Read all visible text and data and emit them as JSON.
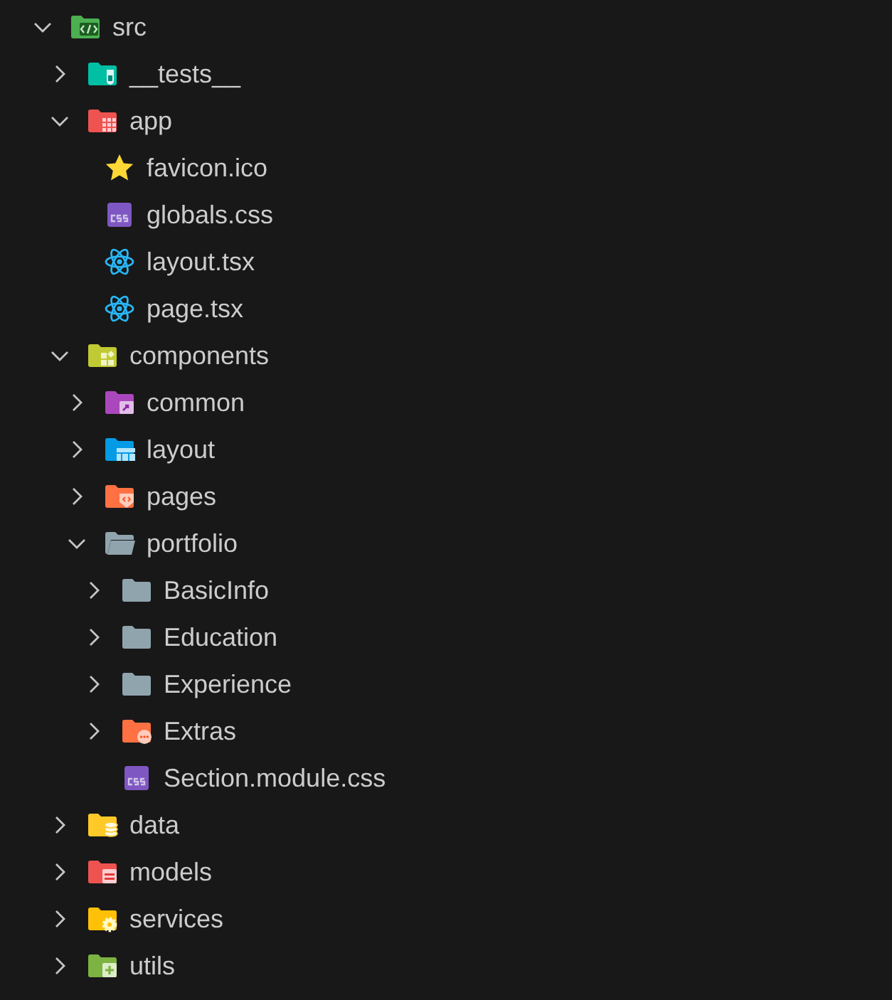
{
  "tree": [
    {
      "name": "src",
      "kind": "src",
      "expanded": true,
      "children": [
        {
          "name": "__tests__",
          "kind": "tests",
          "expanded": false
        },
        {
          "name": "app",
          "kind": "app",
          "expanded": true,
          "children": [
            {
              "name": "favicon.ico",
              "kind": "star"
            },
            {
              "name": "globals.css",
              "kind": "css"
            },
            {
              "name": "layout.tsx",
              "kind": "react"
            },
            {
              "name": "page.tsx",
              "kind": "react"
            }
          ]
        },
        {
          "name": "components",
          "kind": "components",
          "expanded": true,
          "children": [
            {
              "name": "common",
              "kind": "common",
              "expanded": false
            },
            {
              "name": "layout",
              "kind": "layout",
              "expanded": false
            },
            {
              "name": "pages",
              "kind": "pages",
              "expanded": false
            },
            {
              "name": "portfolio",
              "kind": "plain",
              "expanded": true,
              "children": [
                {
                  "name": "BasicInfo",
                  "kind": "plain",
                  "expanded": false
                },
                {
                  "name": "Education",
                  "kind": "plain",
                  "expanded": false
                },
                {
                  "name": "Experience",
                  "kind": "plain",
                  "expanded": false
                },
                {
                  "name": "Extras",
                  "kind": "extras",
                  "expanded": false
                },
                {
                  "name": "Section.module.css",
                  "kind": "css"
                }
              ]
            }
          ]
        },
        {
          "name": "data",
          "kind": "data",
          "expanded": false
        },
        {
          "name": "models",
          "kind": "models",
          "expanded": false
        },
        {
          "name": "services",
          "kind": "services",
          "expanded": false
        },
        {
          "name": "utils",
          "kind": "utils",
          "expanded": false
        }
      ]
    }
  ]
}
